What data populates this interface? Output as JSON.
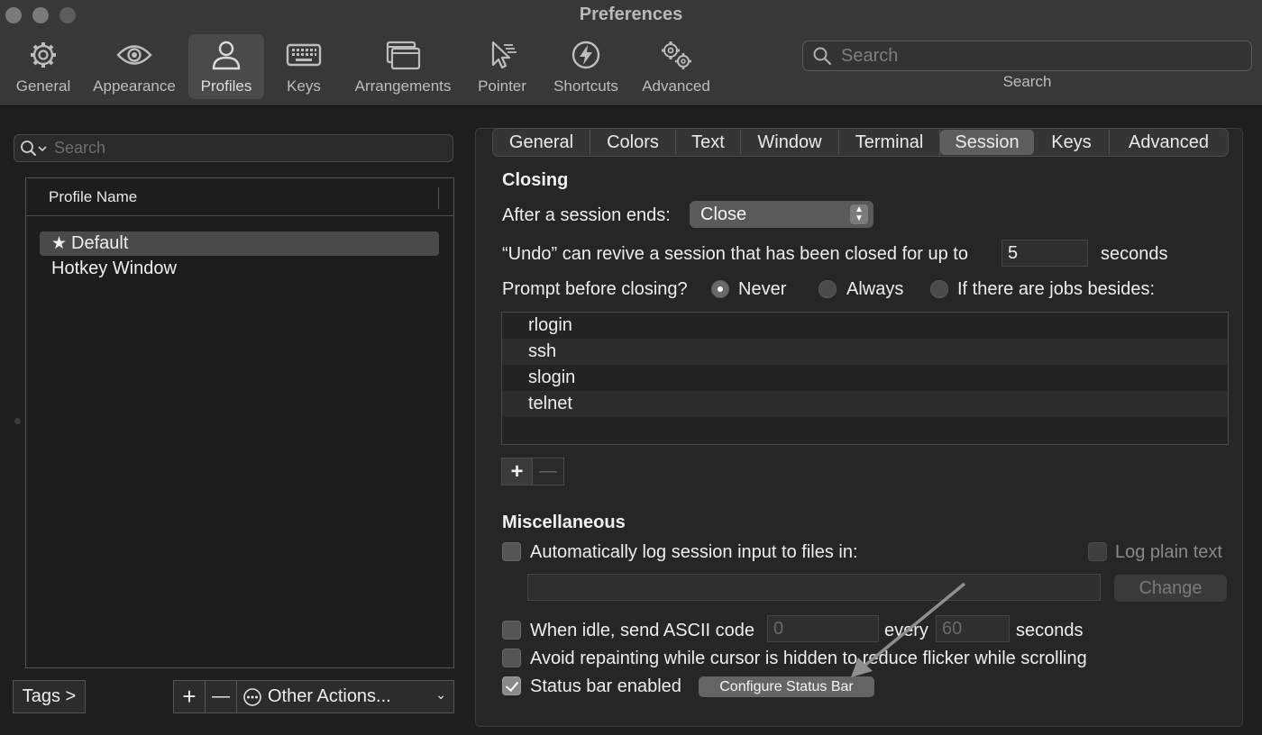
{
  "window": {
    "title": "Preferences"
  },
  "toolbar": {
    "items": [
      {
        "label": "General",
        "icon": "gear-icon"
      },
      {
        "label": "Appearance",
        "icon": "eye-icon"
      },
      {
        "label": "Profiles",
        "icon": "person-icon",
        "active": true
      },
      {
        "label": "Keys",
        "icon": "keyboard-icon"
      },
      {
        "label": "Arrangements",
        "icon": "windows-icon"
      },
      {
        "label": "Pointer",
        "icon": "pointer-icon"
      },
      {
        "label": "Shortcuts",
        "icon": "lightning-icon"
      },
      {
        "label": "Advanced",
        "icon": "gears-icon"
      }
    ],
    "search": {
      "placeholder": "Search",
      "caption": "Search"
    }
  },
  "profiles": {
    "search_placeholder": "Search",
    "column_header": "Profile Name",
    "items": [
      {
        "label": "Default",
        "starred": true,
        "selected": true
      },
      {
        "label": "Hotkey Window",
        "starred": false,
        "selected": false
      }
    ],
    "tags_button": "Tags >",
    "add_symbol": "+",
    "remove_symbol": "—",
    "other_actions": "Other Actions..."
  },
  "tabs": [
    {
      "label": "General"
    },
    {
      "label": "Colors"
    },
    {
      "label": "Text"
    },
    {
      "label": "Window"
    },
    {
      "label": "Terminal"
    },
    {
      "label": "Session",
      "active": true
    },
    {
      "label": "Keys"
    },
    {
      "label": "Advanced"
    }
  ],
  "closing": {
    "title": "Closing",
    "after_session_label": "After a session ends:",
    "after_session_value": "Close",
    "undo_label": "“Undo” can revive a session that has been closed for up to",
    "undo_value": "5",
    "undo_unit": "seconds",
    "prompt_label": "Prompt before closing?",
    "prompt_options": [
      {
        "label": "Never",
        "selected": true
      },
      {
        "label": "Always",
        "selected": false
      },
      {
        "label": "If there are jobs besides:",
        "selected": false
      }
    ],
    "jobs": [
      "rlogin",
      "ssh",
      "slogin",
      "telnet"
    ],
    "add_job": "+",
    "remove_job": "—"
  },
  "misc": {
    "title": "Miscellaneous",
    "log_label": "Automatically log session input to files in:",
    "log_checked": false,
    "log_plain_label": "Log plain text",
    "log_path": "",
    "change_button": "Change",
    "idle_label": "When idle, send ASCII code",
    "idle_code": "0",
    "idle_every": "every",
    "idle_seconds_value": "60",
    "idle_seconds_unit": "seconds",
    "avoid_label": "Avoid repainting while cursor is hidden to reduce flicker while scrolling",
    "status_bar_label": "Status bar enabled",
    "status_bar_checked": true,
    "configure_button": "Configure Status Bar"
  },
  "colors": {
    "toolbar_bg": "#383838",
    "window_bg": "#1e1e1e",
    "panel_bg": "#262626",
    "selected_bg": "#4a4a4a",
    "text": "#e6e6e6"
  }
}
